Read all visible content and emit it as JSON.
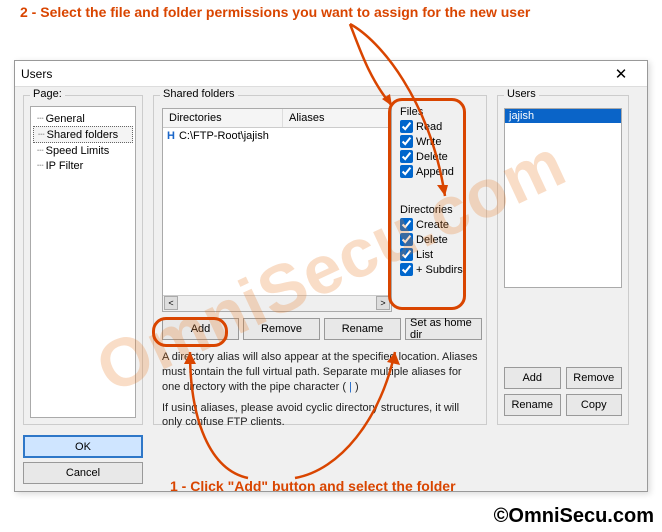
{
  "annotations": {
    "top": "2 - Select the file and folder permissions you want to assign for the new user",
    "bottom": "1 - Click \"Add\" button and select the folder",
    "copyright": "©OmniSecu.com",
    "watermark": "OmniSecu.com"
  },
  "dialog": {
    "title": "Users",
    "close": "✕"
  },
  "page": {
    "label": "Page:",
    "items": [
      "General",
      "Shared folders",
      "Speed Limits",
      "IP Filter"
    ],
    "selected_index": 1
  },
  "shared": {
    "label": "Shared folders",
    "columns": {
      "c1": "Directories",
      "c2": "Aliases"
    },
    "rows": [
      {
        "marker": "H",
        "path": "C:\\FTP-Root\\jajish",
        "alias": ""
      }
    ],
    "scroll": {
      "left": "<",
      "right": ">"
    },
    "buttons": {
      "add": "Add",
      "remove": "Remove",
      "rename": "Rename",
      "sethome": "Set as home dir"
    },
    "files_label": "Files",
    "files_perms": [
      {
        "label": "Read",
        "checked": true
      },
      {
        "label": "Write",
        "checked": true
      },
      {
        "label": "Delete",
        "checked": true
      },
      {
        "label": "Append",
        "checked": true
      }
    ],
    "dirs_label": "Directories",
    "dirs_perms": [
      {
        "label": "Create",
        "checked": true
      },
      {
        "label": "Delete",
        "checked": true
      },
      {
        "label": "List",
        "checked": true
      },
      {
        "label": "+ Subdirs",
        "checked": true
      }
    ],
    "note1a": "A directory alias will also appear at the specified location. Aliases must contain the full virtual path. Separate multiple aliases for one directory with the pipe character (",
    "note1b": " | ",
    "note1c": ")",
    "note2": "If using aliases, please avoid cyclic directory structures, it will only confuse FTP clients."
  },
  "users": {
    "label": "Users",
    "items": [
      "jajish"
    ],
    "selected_index": 0,
    "buttons": {
      "add": "Add",
      "remove": "Remove",
      "rename": "Rename",
      "copy": "Copy"
    }
  },
  "footer": {
    "ok": "OK",
    "cancel": "Cancel"
  }
}
